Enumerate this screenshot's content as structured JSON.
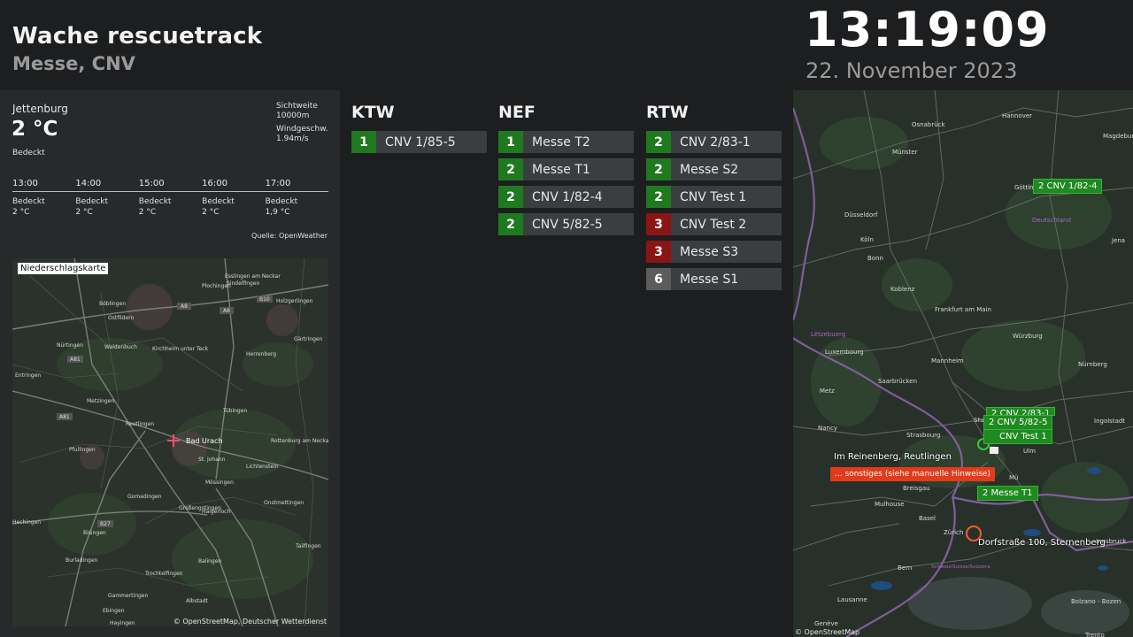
{
  "header": {
    "title": "Wache rescuetrack",
    "subtitle": "Messe, CNV",
    "time": "13:19:09",
    "date": "22. November 2023"
  },
  "weather": {
    "city": "Jettenburg",
    "temperature": "2 °C",
    "condition": "Bedeckt",
    "visibility_label": "Sichtweite",
    "visibility_value": "10000m",
    "wind_label": "Windgeschw.",
    "wind_value": "1.94m/s",
    "forecast": [
      {
        "time": "13:00",
        "condition": "Bedeckt",
        "temp": "2 °C"
      },
      {
        "time": "14:00",
        "condition": "Bedeckt",
        "temp": "2 °C"
      },
      {
        "time": "15:00",
        "condition": "Bedeckt",
        "temp": "2 °C"
      },
      {
        "time": "16:00",
        "condition": "Bedeckt",
        "temp": "2 °C"
      },
      {
        "time": "17:00",
        "condition": "Bedeckt",
        "temp": "1,9 °C"
      }
    ],
    "source": "Quelle: OpenWeather"
  },
  "precip_map": {
    "label": "Niederschlagskarte",
    "copyright": "© OpenStreetMap, Deutscher Wetterdienst",
    "places": [
      "Esslingen am Neckar",
      "Sindelfingen",
      "Böblingen",
      "Ostfildern",
      "Plochingen",
      "Holzgerlingen",
      "Waldenbuch",
      "Kirchheim unter Teck",
      "Gärtringen",
      "Nürtingen",
      "Herrenberg",
      "Entringen",
      "Metzingen",
      "Tübingen",
      "Reutlingen",
      "Bad Urach",
      "Rottenburg am Neckar",
      "Pfullingen",
      "St. Johann",
      "Lichtenstein",
      "Mössingen",
      "Gomadingen",
      "Onstmettingen",
      "Großengstingen",
      "Haigerloch",
      "Hechingen",
      "Bisingen",
      "Burladingen",
      "Trochtelfingen",
      "Balingen",
      "Tailfingen",
      "Gammertingen",
      "Albstadt",
      "Ebingen",
      "Hayingen"
    ],
    "roads": [
      "A8",
      "A8",
      "B10",
      "A81",
      "A81",
      "B27"
    ]
  },
  "columns": [
    {
      "title": "KTW",
      "vehicles": [
        {
          "status": "1",
          "name": "CNV 1/85-5"
        }
      ]
    },
    {
      "title": "NEF",
      "vehicles": [
        {
          "status": "1",
          "name": "Messe T2"
        },
        {
          "status": "2",
          "name": "Messe T1"
        },
        {
          "status": "2",
          "name": "CNV 1/82-4"
        },
        {
          "status": "2",
          "name": "CNV 5/82-5"
        }
      ]
    },
    {
      "title": "RTW",
      "vehicles": [
        {
          "status": "2",
          "name": "CNV 2/83-1"
        },
        {
          "status": "2",
          "name": "Messe S2"
        },
        {
          "status": "2",
          "name": "CNV Test 1"
        },
        {
          "status": "3",
          "name": "CNV Test 2"
        },
        {
          "status": "3",
          "name": "Messe S3"
        },
        {
          "status": "6",
          "name": "Messe S1"
        }
      ]
    }
  ],
  "big_map": {
    "markers": {
      "m1": "2 CNV 1/82-4",
      "m2": "2 CNV 2/83-1",
      "m3": "2 CNV 5/82-5",
      "m4": "CNV Test 1",
      "m5": "2 Messe T1"
    },
    "alarm_address": "Im Reinenberg, Reutlingen",
    "alarm_type": "... sonstiges (siehe manuelle Hinweise)",
    "incident_address": "Dorfstraße 100, Sternenberg",
    "copyright": "© OpenStreetMap",
    "places": [
      "Hannover",
      "Osnabrück",
      "Magdebur",
      "Münster",
      "Göttin",
      "Deutschland",
      "Düsseldorf",
      "Köln",
      "Bonn",
      "Jena",
      "Koblenz",
      "Frankfurt am Main",
      "Luxembourg",
      "Würzburg",
      "Lëtzebuerg",
      "Mannheim",
      "Nürnberg",
      "Saarbrücken",
      "Metz",
      "Stut",
      "Ingolstadt",
      "Nancy",
      "Strasbourg",
      "Ulm",
      "Breisgau",
      "Mü",
      "Mulhouse",
      "Basel",
      "Zürich",
      "Innsbruck",
      "Schweiz/Suisse/Svizzera",
      "Bern",
      "Lausanne",
      "Bolzano - Bozen",
      "Genève",
      "Trento"
    ]
  },
  "colors": {
    "status_green": "#1f7a1f",
    "status_red": "#8b1414",
    "status_grey": "#5c5c5c",
    "alarm_red": "#e33a1c"
  }
}
